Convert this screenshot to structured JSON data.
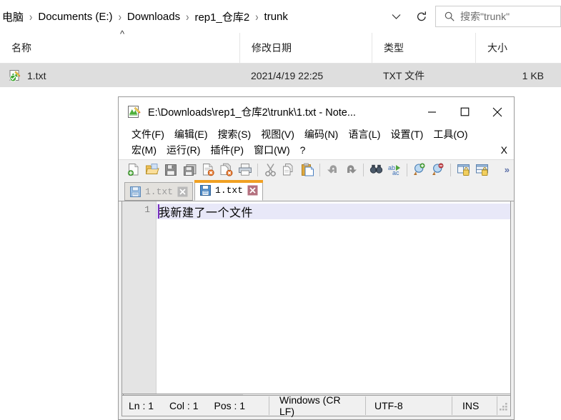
{
  "explorer": {
    "breadcrumb": {
      "name": "address-breadcrumb",
      "crumbs": [
        "电脑",
        "Documents (E:)",
        "Downloads",
        "rep1_仓库2",
        "trunk"
      ],
      "separator": "›",
      "dropdown_glyph": "⌄",
      "refresh_glyph": "↻"
    },
    "search": {
      "placeholder": "搜索\"trunk\"",
      "icon": "search-icon"
    },
    "columns": [
      {
        "label": "名称",
        "sorted": true,
        "sort_glyph": "^"
      },
      {
        "label": "修改日期",
        "sorted": false
      },
      {
        "label": "类型",
        "sorted": false
      },
      {
        "label": "大小",
        "sorted": false
      }
    ],
    "rows": [
      {
        "icon": "notepadpp-file-icon",
        "name": "1.txt",
        "date": "2021/4/19 22:25",
        "type": "TXT 文件",
        "size": "1 KB",
        "selected": true
      }
    ]
  },
  "notepad": {
    "title": "E:\\Downloads\\rep1_仓库2\\trunk\\1.txt - Note...",
    "title_icon": "notepadpp-icon",
    "window_controls": {
      "minimize": "minimize-button",
      "maximize": "maximize-button",
      "close": "close-button"
    },
    "menu_row1": [
      "文件(F)",
      "编辑(E)",
      "搜索(S)",
      "视图(V)",
      "编码(N)",
      "语言(L)",
      "设置(T)",
      "工具(O)"
    ],
    "menu_row2": [
      "宏(M)",
      "运行(R)",
      "插件(P)",
      "窗口(W)",
      "?"
    ],
    "menu_close_doc": "X",
    "toolbar": {
      "overflow_glyph": "»",
      "buttons": [
        "new-file-icon",
        "open-file-icon",
        "save-icon",
        "save-all-icon",
        "close-file-icon",
        "close-all-icon",
        "print-icon",
        "cut-icon",
        "copy-icon",
        "paste-icon",
        "undo-icon",
        "redo-icon",
        "find-icon",
        "replace-icon",
        "zoom-in-icon",
        "zoom-out-icon",
        "sync-vertical-icon",
        "sync-horizontal-icon"
      ]
    },
    "tabs": [
      {
        "label": "1.txt",
        "active": false,
        "save_icon": "floppy-icon",
        "close_icon": "close-tab-icon"
      },
      {
        "label": "1.txt",
        "active": true,
        "save_icon": "floppy-icon",
        "close_icon": "close-tab-icon"
      }
    ],
    "editor": {
      "line_numbers": [
        "1"
      ],
      "lines": [
        "我新建了一个文件"
      ]
    },
    "status": {
      "ln_label": "Ln : 1",
      "col_label": "Col : 1",
      "pos_label": "Pos : 1",
      "eol": "Windows (CR LF)",
      "encoding": "UTF-8",
      "insert_mode": "INS"
    }
  },
  "colors": {
    "tab_active_accent": "#f0a022",
    "selection_row": "#dedede",
    "active_line": "#e8e8f8",
    "caret": "#7a2fbf"
  }
}
